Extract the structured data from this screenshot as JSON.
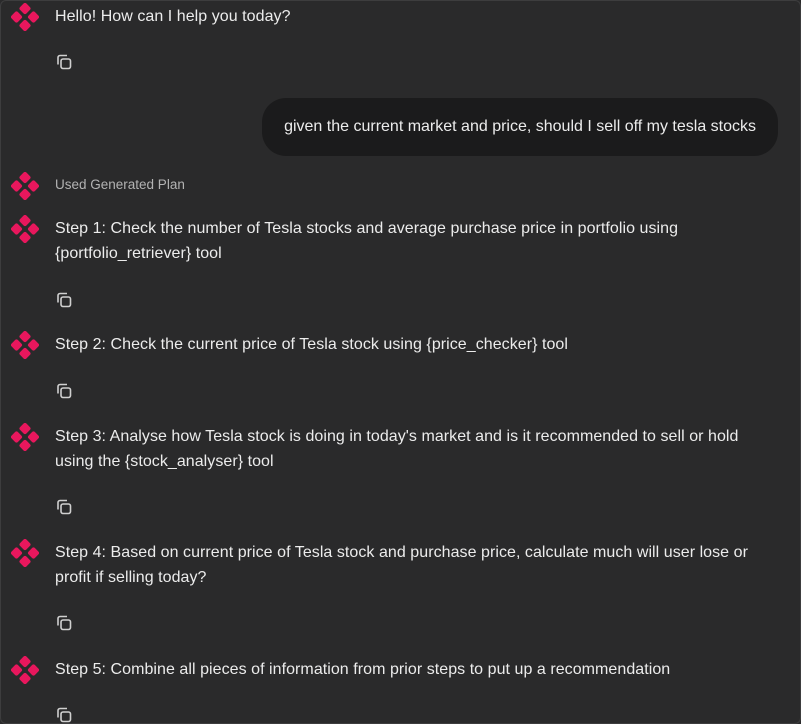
{
  "chat": {
    "greeting": "Hello! How can I help you today?",
    "user_message": "given the current market and price, should I sell off my tesla stocks",
    "plan_label": "Used Generated Plan",
    "steps": [
      "Step 1: Check the number of Tesla stocks and average purchase price in portfolio using {portfolio_retriever} tool",
      "Step 2: Check the current price of Tesla stock using {price_checker} tool",
      "Step 3: Analyse how Tesla stock is doing in today's market and is it recommended to sell or hold using the {stock_analyser} tool",
      "Step 4: Based on current price of Tesla stock and purchase price, calculate much will user lose or profit if selling today?",
      "Step 5: Combine all pieces of information from prior steps to put up a recommendation"
    ]
  },
  "colors": {
    "background": "#2a2a2b",
    "user_bubble": "#1b1b1c",
    "text": "#ececec",
    "muted_text": "#b3b3b3",
    "avatar_accent": "#e8175d"
  },
  "icons": {
    "assistant_avatar": "pink-diamond-cluster-icon",
    "copy": "copy-icon"
  }
}
